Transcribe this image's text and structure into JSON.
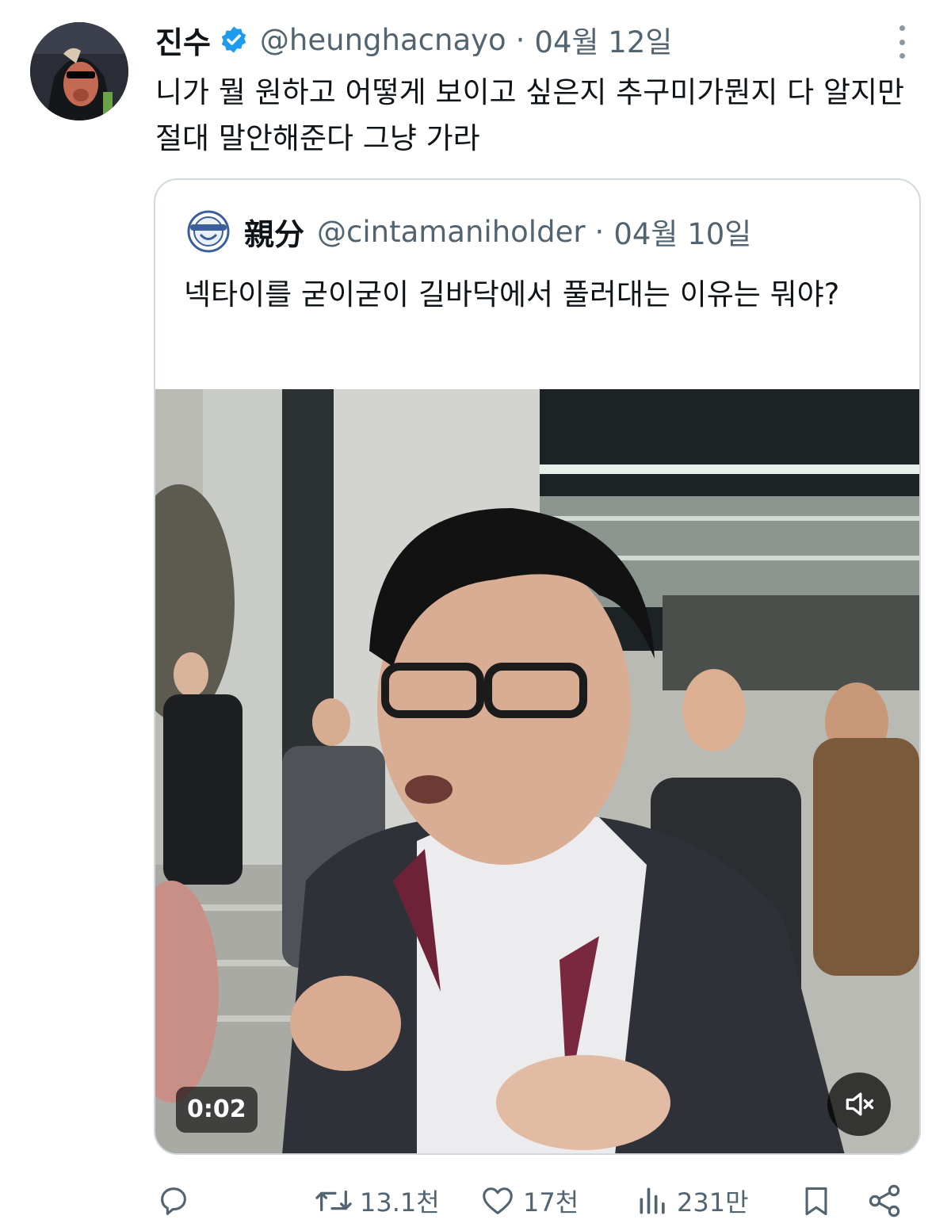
{
  "tweet": {
    "display_name": "진수",
    "verified": true,
    "handle": "@heunghacnayo",
    "separator": "·",
    "date": "04월 12일",
    "text": "니가 뭘 원하고 어떻게 보이고 싶은지 추구미가뭔지 다 알지만 절대 말안해준다 그냥 가라",
    "avatar_icon": "masked-figure-avatar"
  },
  "quoted_tweet": {
    "display_name": "親分",
    "handle": "@cintamaniholder",
    "separator": "·",
    "date": "04월 10일",
    "text": "넥타이를 굳이굳이 길바닥에서 풀러대는 이유는 뭐야?",
    "avatar_icon": "laughing-man-logo",
    "video": {
      "timestamp": "0:02",
      "muted": true
    }
  },
  "actions": {
    "reply": {
      "icon": "reply-icon",
      "count": ""
    },
    "retweet": {
      "icon": "retweet-icon",
      "count": "13.1천"
    },
    "like": {
      "icon": "heart-icon",
      "count": "17천"
    },
    "views": {
      "icon": "views-icon",
      "count": "231만"
    },
    "bookmark": {
      "icon": "bookmark-icon"
    },
    "share": {
      "icon": "share-icon"
    }
  },
  "colors": {
    "text_primary": "#0f1419",
    "text_secondary": "#536471",
    "verified_blue": "#1d9bf0",
    "border": "#cfd9de"
  }
}
